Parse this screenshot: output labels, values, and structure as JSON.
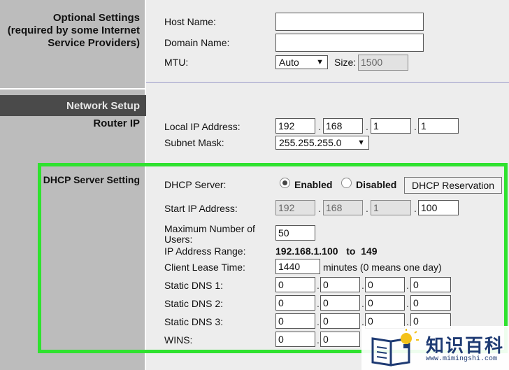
{
  "sidebar": {
    "optional_settings": [
      "Optional Settings",
      "(required by some Internet",
      "Service Providers)"
    ],
    "network_setup": "Network Setup",
    "router_ip": "Router IP",
    "dhcp_server_setting": "DHCP Server Setting"
  },
  "optional": {
    "host_name_label": "Host Name:",
    "host_name_value": "",
    "domain_name_label": "Domain Name:",
    "domain_name_value": "",
    "mtu_label": "MTU:",
    "mtu_value": "Auto",
    "size_label": "Size:",
    "size_value": "1500"
  },
  "router": {
    "local_ip_label": "Local IP Address:",
    "local_ip": [
      "192",
      "168",
      "1",
      "1"
    ],
    "subnet_label": "Subnet Mask:",
    "subnet_value": "255.255.255.0"
  },
  "dhcp": {
    "server_label": "DHCP Server:",
    "enabled_label": "Enabled",
    "disabled_label": "Disabled",
    "selected": "Enabled",
    "reservation_button": "DHCP Reservation",
    "start_ip_label": "Start IP Address:",
    "start_ip": [
      "192",
      "168",
      "1",
      "100"
    ],
    "max_users_label_1": "Maximum Number of",
    "max_users_label_2": "Users:",
    "max_users_value": "50",
    "range_label": "IP Address Range:",
    "range_value": "192.168.1.100   to  149",
    "lease_label": "Client Lease Time:",
    "lease_value": "1440",
    "lease_note": "minutes (0 means one day)",
    "dns1_label": "Static DNS 1:",
    "dns1": [
      "0",
      "0",
      "0",
      "0"
    ],
    "dns2_label": "Static DNS 2:",
    "dns2": [
      "0",
      "0",
      "0",
      "0"
    ],
    "dns3_label": "Static DNS 3:",
    "dns3": [
      "0",
      "0",
      "0",
      "0"
    ],
    "wins_label": "WINS:",
    "wins": [
      "0",
      "0"
    ]
  },
  "watermark": {
    "title": "知识百科",
    "url": "www.mimingshi.com"
  },
  "colors": {
    "highlight": "#2fe22f",
    "sidebar_bg": "#bcbcbc",
    "network_bar": "#4a4a4a"
  }
}
